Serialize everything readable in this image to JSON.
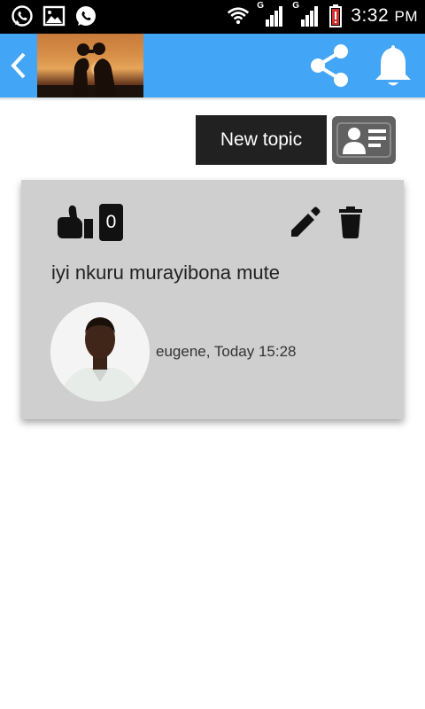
{
  "status_bar": {
    "time": "3:32",
    "ampm": "PM",
    "network_1": "G",
    "network_2": "G",
    "icons": [
      "whatsapp-icon",
      "image-icon",
      "whatsapp-icon",
      "wifi-icon",
      "signal-icon",
      "signal-icon",
      "battery-low-icon"
    ]
  },
  "app_bar": {
    "color": "#42A5F5",
    "back_icon": "chevron-left-icon",
    "share_icon": "share-icon",
    "bell_icon": "bell-icon"
  },
  "actions": {
    "new_topic_label": "New topic",
    "contact_icon": "contact-card-icon"
  },
  "topic": {
    "likes": "0",
    "text": "iyi nkuru murayibona mute",
    "author_line": "eugene, Today 15:28"
  }
}
